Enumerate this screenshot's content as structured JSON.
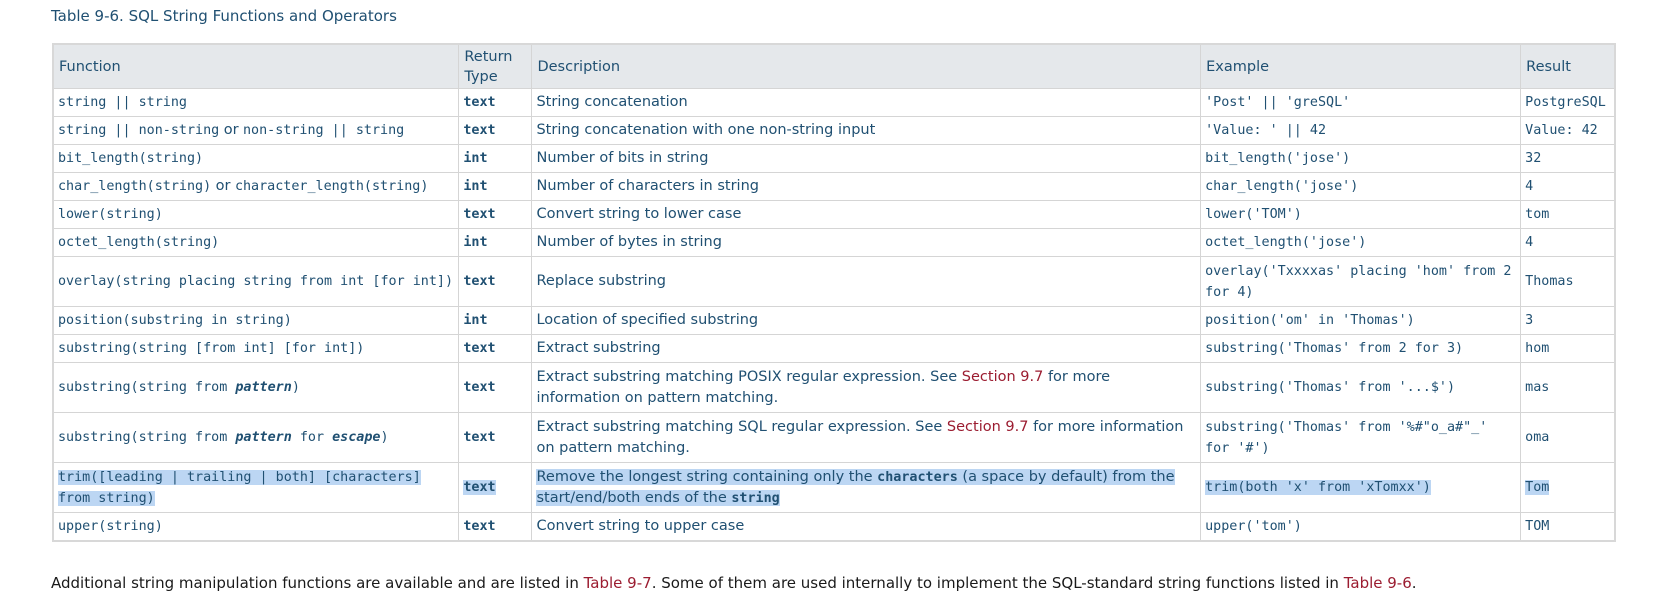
{
  "caption": "Table 9-6. SQL String Functions and Operators",
  "headers": {
    "function": "Function",
    "return_type": "Return Type",
    "description": "Description",
    "example": "Example",
    "result": "Result"
  },
  "rows": [
    {
      "fn_a": "string || string",
      "rt": "text",
      "desc_a": "String concatenation",
      "example": "'Post' || 'greSQL'",
      "result": "PostgreSQL"
    },
    {
      "fn_a": "string || non-string",
      "fn_or": "or",
      "fn_b": "non-string || string",
      "rt": "text",
      "desc_a": "String concatenation with one non-string input",
      "example": "'Value: ' || 42",
      "result": "Value: 42"
    },
    {
      "fn_a": "bit_length(string)",
      "rt": "int",
      "desc_a": "Number of bits in string",
      "example": "bit_length('jose')",
      "result": "32"
    },
    {
      "fn_a": "char_length(string)",
      "fn_or": "or",
      "fn_b": "character_length(string)",
      "rt": "int",
      "desc_a": "Number of characters in string",
      "example": "char_length('jose')",
      "result": "4"
    },
    {
      "fn_a": "lower(string)",
      "rt": "text",
      "desc_a": "Convert string to lower case",
      "example": "lower('TOM')",
      "result": "tom"
    },
    {
      "fn_a": "octet_length(string)",
      "rt": "int",
      "desc_a": "Number of bytes in string",
      "example": "octet_length('jose')",
      "result": "4"
    },
    {
      "fn_a": "overlay(string placing string from int [for int])",
      "rt": "text",
      "desc_a": "Replace substring",
      "example": "overlay('Txxxxas' placing 'hom' from 2 for 4)",
      "result": "Thomas"
    },
    {
      "fn_a": "position(substring in string)",
      "rt": "int",
      "desc_a": "Location of specified substring",
      "example": "position('om' in 'Thomas')",
      "result": "3"
    },
    {
      "fn_a": "substring(string [from int] [for int])",
      "rt": "text",
      "desc_a": "Extract substring",
      "example": "substring('Thomas' from 2 for 3)",
      "result": "hom"
    },
    {
      "fn_a": "substring(string from ",
      "fn_em1": "pattern",
      "fn_c": ")",
      "rt": "text",
      "desc_a": "Extract substring matching POSIX regular expression. See ",
      "desc_link": "Section 9.7",
      "desc_b": " for more information on pattern matching.",
      "example": "substring('Thomas' from '...$')",
      "result": "mas"
    },
    {
      "fn_a": "substring(string from ",
      "fn_em1": "pattern",
      "fn_mid": " for ",
      "fn_em2": "escape",
      "fn_c": ")",
      "rt": "text",
      "desc_a": "Extract substring matching SQL regular expression. See ",
      "desc_link": "Section 9.7",
      "desc_b": " for more information on pattern matching.",
      "example": "substring('Thomas' from '%#\"o_a#\"_' for '#')",
      "result": "oma"
    },
    {
      "fn_a": "trim([leading | trailing | both] [characters] from string)",
      "rt": "text",
      "desc_a": "Remove the longest string containing only the ",
      "desc_code1": "characters",
      "desc_b": " (a space by default) from the start/end/both ends of the ",
      "desc_code2": "string",
      "example": "trim(both 'x' from 'xTomxx')",
      "result": "Tom",
      "selected": true
    },
    {
      "fn_a": "upper(string)",
      "rt": "text",
      "desc_a": "Convert string to upper case",
      "example": "upper('tom')",
      "result": "TOM"
    }
  ],
  "footer": {
    "text_a": "Additional string manipulation functions are available and are listed in ",
    "link_a": "Table 9-7",
    "text_b": ". Some of them are used internally to implement the SQL-standard string functions listed in ",
    "link_b": "Table 9-6",
    "text_c": "."
  },
  "colors": {
    "heading": "#205072",
    "link": "#9b1c30",
    "header_bg": "#e5e8eb",
    "selection": "#bcd6f3"
  }
}
